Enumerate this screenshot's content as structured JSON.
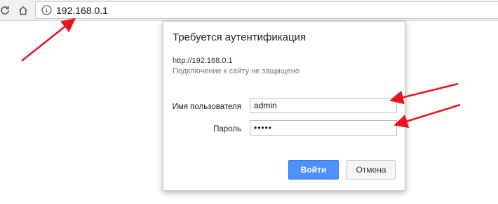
{
  "browser": {
    "url": "192.168.0.1",
    "icons": {
      "reload": "reload-icon",
      "home": "home-icon",
      "info": "info-icon"
    }
  },
  "dialog": {
    "title": "Требуется аутентификация",
    "site": "http://192.168.0.1",
    "warning": "Подключение к сайту не защищено",
    "username_label": "Имя пользователя",
    "username_value": "admin",
    "password_label": "Пароль",
    "password_value": "•••••",
    "login_button": "Войти",
    "cancel_button": "Отмена"
  },
  "colors": {
    "primary_button": "#4d90fe",
    "annotation_arrow": "#e8141c"
  }
}
